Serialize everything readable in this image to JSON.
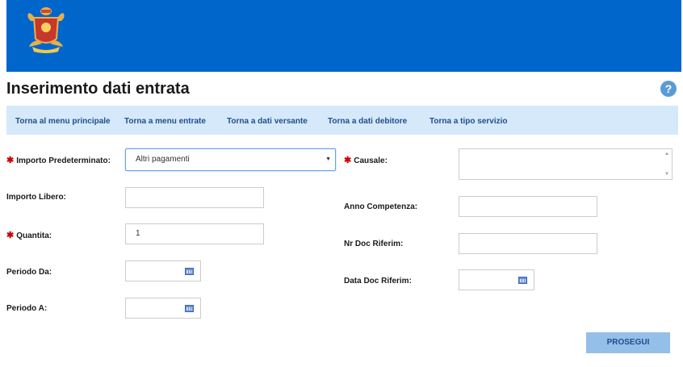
{
  "header": {
    "logo_icon": "coat-of-arms-icon",
    "background": "#0066cc"
  },
  "page": {
    "title": "Inserimento dati entrata",
    "help_label": "?"
  },
  "nav": [
    {
      "label": "Torna al menu principale"
    },
    {
      "label": "Torna a menu entrate"
    },
    {
      "label": "Torna a dati versante"
    },
    {
      "label": "Torna a dati debitore"
    },
    {
      "label": "Torna a tipo servizio"
    }
  ],
  "form": {
    "required_mark": "✱",
    "importo_predeterminato": {
      "label": "Importo Predeterminato:",
      "value": "Altri pagamenti"
    },
    "importo_libero": {
      "label": "Importo Libero:",
      "value": ""
    },
    "quantita": {
      "label": "Quantita:",
      "value": "1"
    },
    "periodo_da": {
      "label": "Periodo Da:",
      "value": ""
    },
    "periodo_a": {
      "label": "Periodo A:",
      "value": ""
    },
    "causale": {
      "label": "Causale:",
      "value": ""
    },
    "anno_competenza": {
      "label": "Anno Competenza:",
      "value": ""
    },
    "nr_doc_riferim": {
      "label": "Nr Doc Riferim:",
      "value": ""
    },
    "data_doc_riferim": {
      "label": "Data Doc Riferim:",
      "value": ""
    }
  },
  "actions": {
    "prosegui_label": "PROSEGUI"
  },
  "colors": {
    "header": "#0066cc",
    "nav_bg": "#d6e9fb",
    "link": "#1f4e8c",
    "required": "#cc0000",
    "button": "#94bfe8"
  }
}
